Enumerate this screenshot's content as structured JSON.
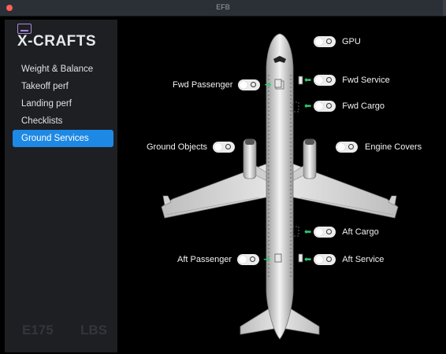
{
  "window": {
    "title": "EFB"
  },
  "sidebar": {
    "logo": "X-CRAFTS",
    "items": [
      {
        "label": "Weight & Balance",
        "active": false
      },
      {
        "label": "Takeoff perf",
        "active": false
      },
      {
        "label": "Landing perf",
        "active": false
      },
      {
        "label": "Checklists",
        "active": false
      },
      {
        "label": "Ground Services",
        "active": true
      }
    ],
    "footer": {
      "model": "E175",
      "units": "LBS"
    }
  },
  "ground_services": {
    "gpu": {
      "label": "GPU",
      "on": false
    },
    "fwd_passenger": {
      "label": "Fwd Passenger",
      "on": false
    },
    "fwd_service": {
      "label": "Fwd Service",
      "on": false
    },
    "fwd_cargo": {
      "label": "Fwd Cargo",
      "on": false
    },
    "ground_objects": {
      "label": "Ground Objects",
      "on": false
    },
    "engine_covers": {
      "label": "Engine Covers",
      "on": false
    },
    "aft_cargo": {
      "label": "Aft Cargo",
      "on": false
    },
    "aft_passenger": {
      "label": "Aft Passenger",
      "on": false
    },
    "aft_service": {
      "label": "Aft Service",
      "on": false
    }
  },
  "colors": {
    "accent": "#1e88e5",
    "arrow": "#2ecc71",
    "logo_icon": "#a98ad8"
  }
}
